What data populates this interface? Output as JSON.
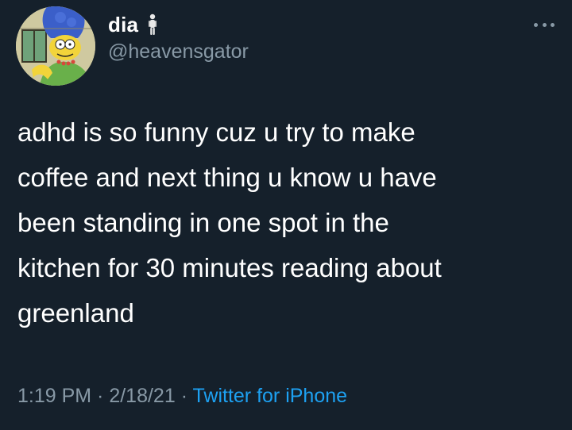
{
  "tweet": {
    "author": {
      "display_name": "dia",
      "name_emoji": "person-standing-emoji",
      "handle": "@heavensgator",
      "avatar": "cartoon-character-avatar"
    },
    "more_icon": "more-dots-icon",
    "text": "adhd is so funny cuz u try to make\ncoffee and next thing u know u have\nbeen standing in one spot in the\nkitchen for 30 minutes reading about\ngreenland",
    "time": "1:19 PM",
    "date": "2/18/21",
    "separator": " · ",
    "source": "Twitter for iPhone"
  },
  "colors": {
    "background": "#15202b",
    "text": "#ffffff",
    "secondary_text": "#8899a6",
    "link": "#1da1f2"
  }
}
